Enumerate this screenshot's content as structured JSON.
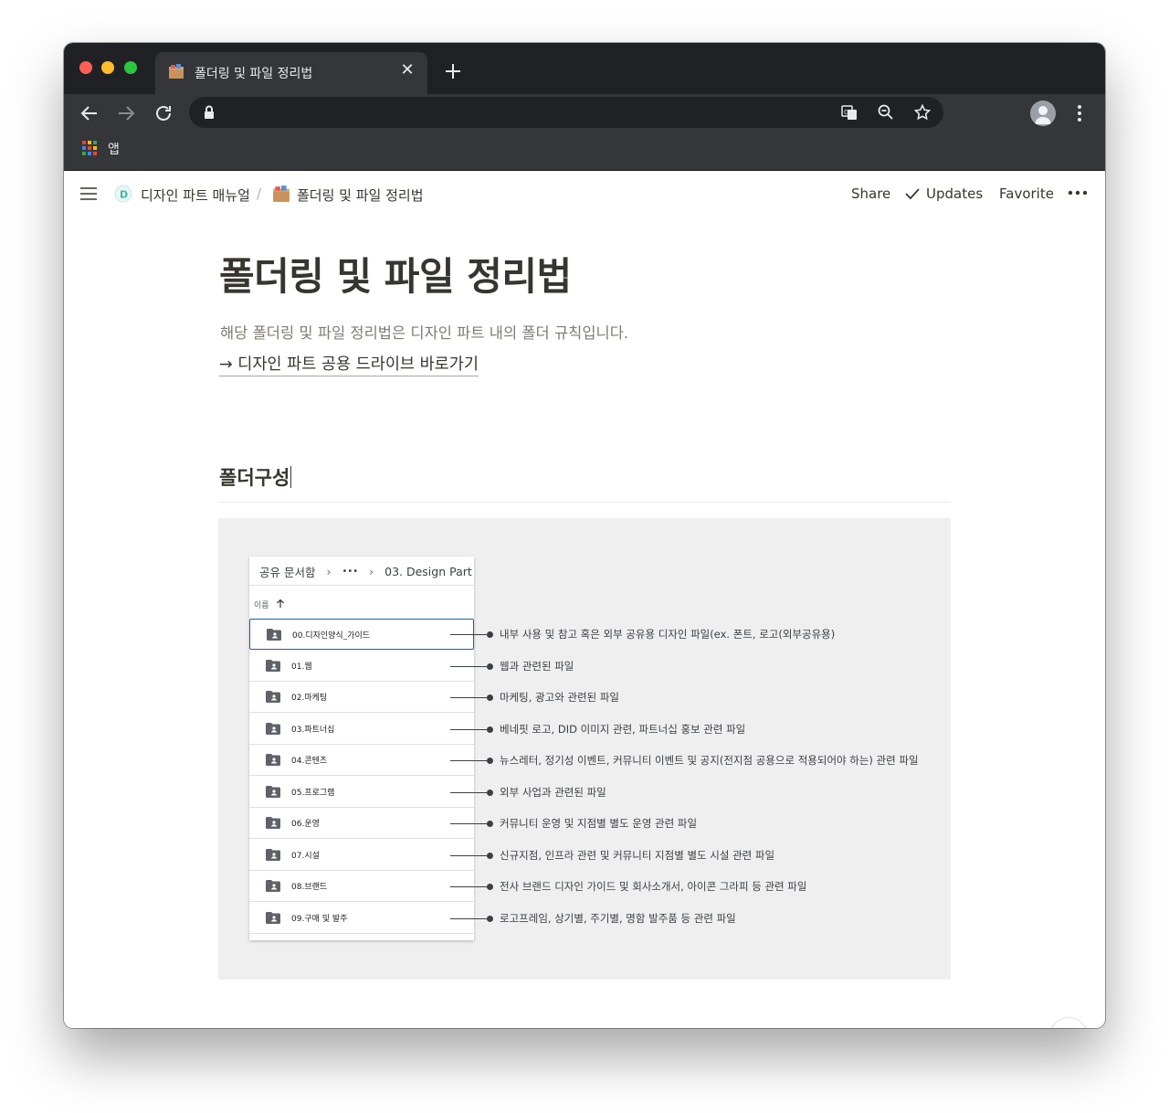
{
  "browser": {
    "tab_title": "폴더링 및 파일 정리법",
    "bookmarks_apps_label": "앱"
  },
  "breadcrumb": {
    "workspace": "디자인 파트 매뉴얼",
    "separator": "/",
    "page": "폴더링 및 파일 정리법"
  },
  "topbar": {
    "share": "Share",
    "updates": "Updates",
    "favorite": "Favorite"
  },
  "page": {
    "title": "폴더링 및 파일 정리법",
    "description": "해당 폴더링 및 파일 정리법은 디자인 파트 내의 폴더 규칙입니다.",
    "drive_link": "→ 디자인 파트 공용 드라이브 바로가기",
    "section_heading": "폴더구성"
  },
  "figure": {
    "breadcrumb_root": "공유 문서함",
    "breadcrumb_ellipsis": "•••",
    "breadcrumb_current": "03. Design Part",
    "sort_label": "이름",
    "folders": [
      {
        "name": "00.디자인양식_가이드",
        "desc": "내부 사용 및 참고 혹은 외부 공유용 디자인 파일(ex. 폰트, 로고(외부공유용)"
      },
      {
        "name": "01.웹",
        "desc": "웹과 관련된 파일"
      },
      {
        "name": "02.마케팅",
        "desc": "마케팅, 광고와 관련된 파일"
      },
      {
        "name": "03.파트너십",
        "desc": "베네핏 로고, DID 이미지 관련, 파트너십 홍보 관련 파일"
      },
      {
        "name": "04.콘텐츠",
        "desc": "뉴스레터, 정기성 이벤트, 커뮤니티 이벤트 및 공지(전지점 공용으로 적용되어야 하는) 관련 파일"
      },
      {
        "name": "05.프로그램",
        "desc": "외부 사업과 관련된 파일"
      },
      {
        "name": "06.운영",
        "desc": "커뮤니티 운영 및 지점별 별도 운영 관련 파일"
      },
      {
        "name": "07.시설",
        "desc": "신규지점, 인프라 관련 및 커뮤니티 지점별 별도 시설 관련 파일"
      },
      {
        "name": "08.브랜드",
        "desc": "전사 브랜드 디자인 가이드 및 회사소개서, 아이콘 그라피 등 관련 파일"
      },
      {
        "name": "09.구매 및 발주",
        "desc": "로고프레임, 상기별, 주기별, 명함 발주품 등 관련 파일"
      }
    ]
  },
  "help_label": "?",
  "colors": {
    "chrome_dark": "#202124",
    "chrome_toolbar": "#35363a",
    "text": "#37352f",
    "muted": "#7d7b76",
    "figure_bg": "#efefef",
    "selection_blue": "#1a5fb4"
  }
}
